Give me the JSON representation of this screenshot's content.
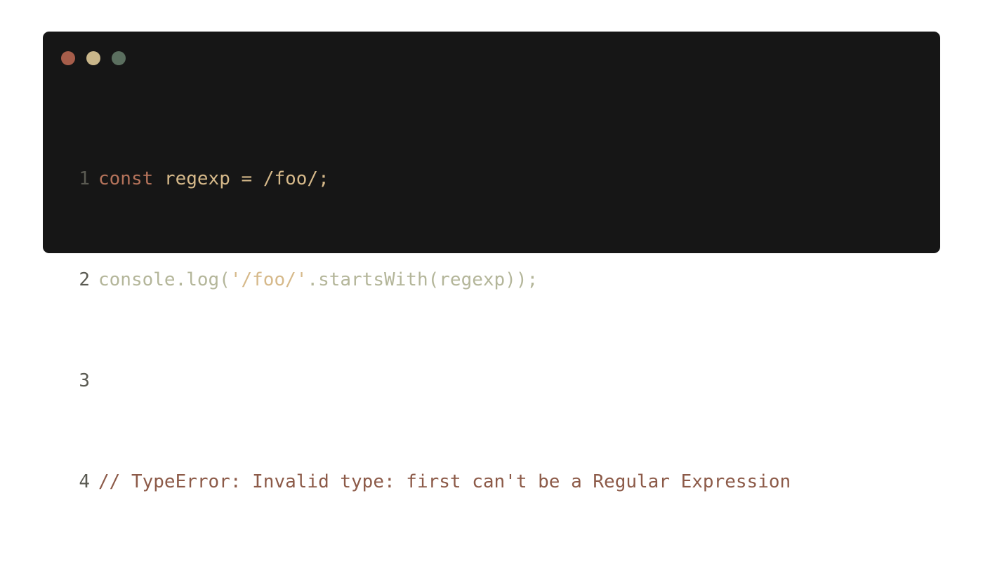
{
  "window": {
    "traffic_lights": {
      "close_color": "#a65d4a",
      "minimize_color": "#c9b68a",
      "maximize_color": "#5b6f5f"
    }
  },
  "code": {
    "lines": [
      {
        "number": "1",
        "tokens": [
          {
            "text": "const",
            "color": "#b5735b"
          },
          {
            "text": " regexp = /foo/;",
            "color": "#d6b98a"
          }
        ]
      },
      {
        "number": "2",
        "tokens": [
          {
            "text": "console.log(",
            "color": "#b4b69a"
          },
          {
            "text": "'/foo/'",
            "color": "#d6b98a"
          },
          {
            "text": ".startsWith(regexp));",
            "color": "#b4b69a"
          }
        ]
      },
      {
        "number": "3",
        "tokens": []
      },
      {
        "number": "4",
        "tokens": [
          {
            "text": "// TypeError: Invalid type: first can't be a Regular Expression",
            "color": "#8c5a48"
          }
        ]
      }
    ]
  }
}
